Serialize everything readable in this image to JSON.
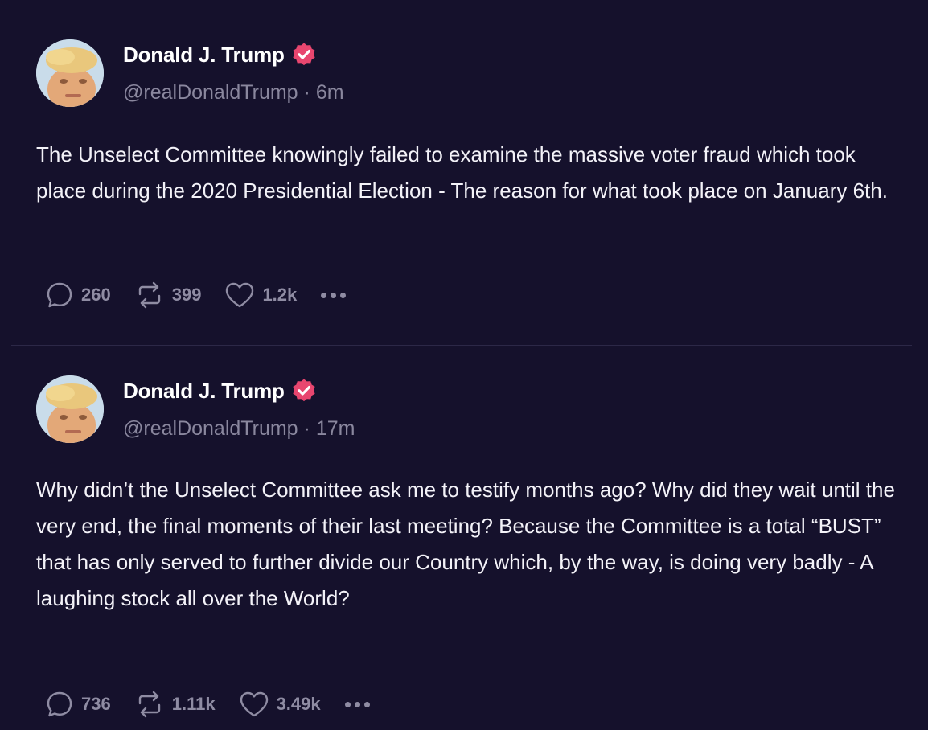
{
  "posts": [
    {
      "author": "Donald J. Trump",
      "handle": "@realDonaldTrump",
      "separator": "·",
      "time": "6m",
      "text": "The Unselect Committee knowingly failed to examine the massive voter fraud which took place during the 2020 Presidential Election - The reason for what took place on January 6th.",
      "replies": "260",
      "retruths": "399",
      "likes": "1.2k"
    },
    {
      "author": "Donald J. Trump",
      "handle": "@realDonaldTrump",
      "separator": "·",
      "time": "17m",
      "text": "Why didn’t the Unselect Committee ask me to testify months ago? Why did they wait until the very end, the final moments of their last meeting? Because the Committee is a total “BUST” that has only served to further divide our Country which, by the way, is doing very badly - A laughing stock all over the World?",
      "replies": "736",
      "retruths": "1.11k",
      "likes": "3.49k"
    }
  ],
  "colors": {
    "background": "#15112c",
    "text": "#f3f2f8",
    "muted": "#8a879e",
    "verified": "#e8466f",
    "divider": "#2c2847"
  },
  "icons": {
    "reply": "speech-bubble-icon",
    "retruth": "repost-arrows-icon",
    "like": "heart-icon",
    "more": "more-dots-icon",
    "verified": "verified-badge-icon"
  }
}
